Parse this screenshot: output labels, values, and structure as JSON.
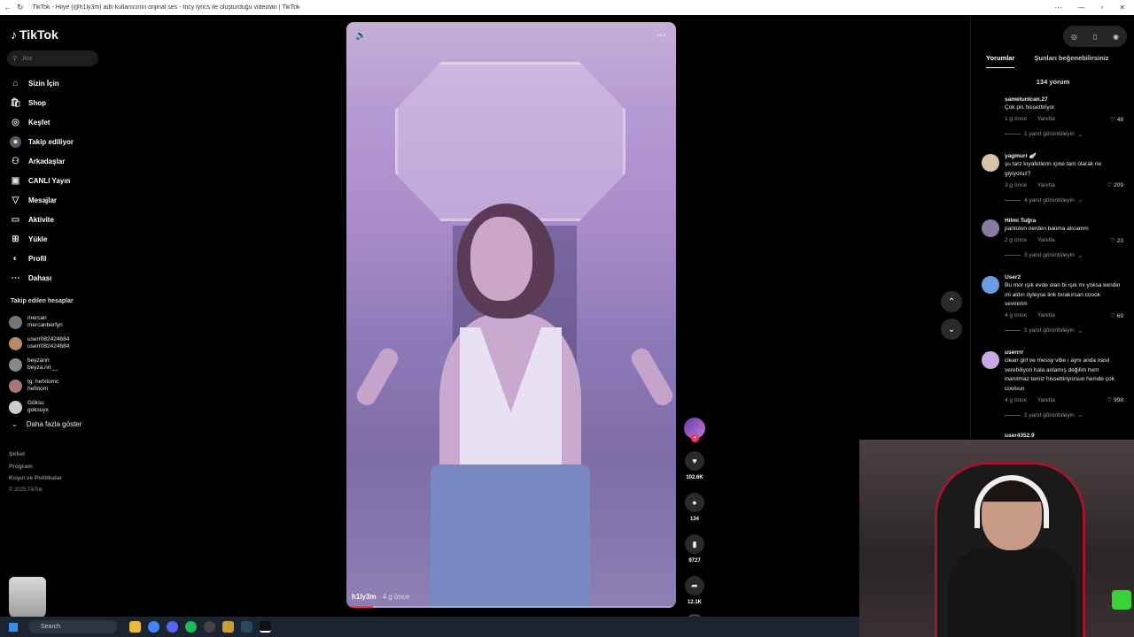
{
  "window": {
    "title": "TikTok - Hilye (@h1ly3m) adlı kullanıcının orijinal ses - tncy lyrics ile oluşturduğu videoları | TikTok"
  },
  "sidebar": {
    "logo": "TikTok",
    "search_placeholder": "Ara",
    "items": [
      {
        "label": "Sizin İçin",
        "icon": "home-icon"
      },
      {
        "label": "Shop",
        "icon": "shop-icon"
      },
      {
        "label": "Keşfet",
        "icon": "compass-icon"
      },
      {
        "label": "Takip ediliyor",
        "icon": "following-avatar-icon"
      },
      {
        "label": "Arkadaşlar",
        "icon": "friends-icon"
      },
      {
        "label": "CANLI Yayın",
        "icon": "live-icon"
      },
      {
        "label": "Mesajlar",
        "icon": "messages-icon"
      },
      {
        "label": "Aktivite",
        "icon": "activity-icon"
      },
      {
        "label": "Yükle",
        "icon": "upload-icon"
      },
      {
        "label": "Profil",
        "icon": "profile-icon"
      },
      {
        "label": "Dahası",
        "icon": "more-icon"
      }
    ],
    "following_title": "Takip edilen hesaplar",
    "following": [
      {
        "name": "mercan",
        "handle": "mercanberfyn"
      },
      {
        "name": "userr082424684",
        "handle": "userr082424684"
      },
      {
        "name": "beyzanrr",
        "handle": "beyza.nrr__"
      },
      {
        "name": "tg: hefxtomc",
        "handle": "hefxtom"
      },
      {
        "name": "Göksu",
        "handle": "goksuyx"
      }
    ],
    "show_more": "Daha fazla göster",
    "footer": [
      "Şirket",
      "Program",
      "Koşul ve Politikalar"
    ],
    "copyright": "© 2025 TikTok"
  },
  "video": {
    "author": "h1ly3m",
    "time": "· 4 g önce",
    "progress": 0.08
  },
  "actions": {
    "likes": "102.6K",
    "comments": "134",
    "saves": "9727",
    "shares": "12.1K",
    "disc_label": "tncy"
  },
  "panel": {
    "tabs": [
      "Yorumlar",
      "Şunları beğenebilirsiniz"
    ],
    "count": "134 yorum",
    "reply_label": "Yanıtla",
    "comments": [
      {
        "user": "sametunlcan.27",
        "text": "Çok pis hissettiriyor",
        "time": "1 g önce",
        "likes": "48",
        "replies": "1 yanıt görüntüleyin"
      },
      {
        "user": "yagmurr 🪽",
        "text": "şu tarz kıyafetlerin içine tam olarak ne giyiyoruz?",
        "time": "3 g önce",
        "likes": "209",
        "replies": "4 yanıt görüntüleyin"
      },
      {
        "user": "Hilmi Tuğra",
        "text": "pantolon nerden balıma alıcamm",
        "time": "2 g önce",
        "likes": "23",
        "replies": "3 yanıt görüntüleyin"
      },
      {
        "user": "User2",
        "text": "Bu mor ışık evde olan bi ışık mı yoksa kendin mi aldın öyleyse link bırakırsan coook sevinirim",
        "time": "4 g önce",
        "likes": "69",
        "replies": "1 yanıt görüntüleyin"
      },
      {
        "user": "userrrr",
        "text": "clean girl ve messy vibe ı aynı anda nasıl verebiliyon hala anlamış değilim hem inanılmaz temiz hissettiriyorsun hemde çok coolsun",
        "time": "4 g önce",
        "likes": "998",
        "replies": "1 yanıt görüntüleyin"
      }
    ],
    "next_user": "user4352.9"
  },
  "taskbar": {
    "search": "Search"
  },
  "colors": {
    "accent": "#fe2c55"
  }
}
